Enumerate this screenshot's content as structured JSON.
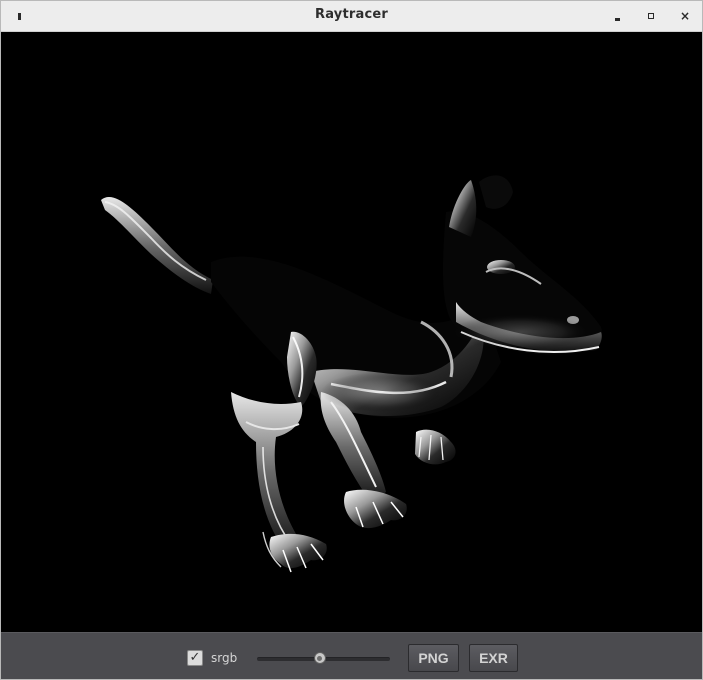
{
  "window": {
    "title": "Raytracer",
    "menu_icon": "window-menu-icon",
    "minimize_icon": "minimize-icon",
    "maximize_icon": "maximize-icon",
    "close_icon": "close-icon",
    "close_glyph": "×"
  },
  "viewport": {
    "content": "rendered image of a reflective metallic dinosaur on a black background",
    "background": "#000000"
  },
  "controls": {
    "srgb_checkbox": {
      "label": "srgb",
      "checked": true,
      "check_glyph": "✓"
    },
    "exposure_slider": {
      "value": 0.47
    },
    "png_button": {
      "label": "PNG"
    },
    "exr_button": {
      "label": "EXR"
    }
  },
  "colors": {
    "titlebar": "#ededed",
    "bottombar": "#4b4b4f",
    "button_text": "#d3d3d3"
  }
}
